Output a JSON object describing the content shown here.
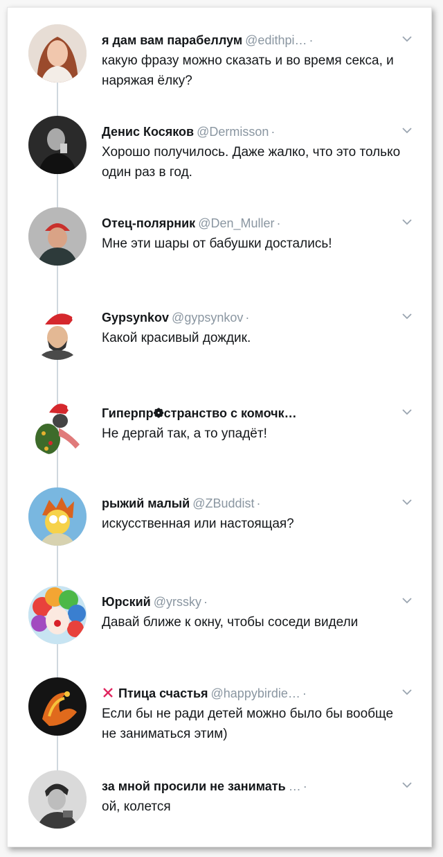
{
  "tweets": [
    {
      "name": "я дам вам парабеллум",
      "handle": "@edithpi…",
      "dot": "·",
      "text": "какую фразу можно сказать и во время секса, и наряжая ёлку?"
    },
    {
      "name": "Денис Косяков",
      "handle": "@Dermisson",
      "dot": "·",
      "text": "Хорошо получилось. Даже жалко, что это только один раз в год."
    },
    {
      "name": "Отец-полярник",
      "handle": "@Den_Muller",
      "dot": "·",
      "text": "Мне эти шары от бабушки достались!"
    },
    {
      "name": "Gypsynkov",
      "handle": "@gypsynkov",
      "dot": "·",
      "text": "Какой красивый дождик."
    },
    {
      "name": "Гиперпр❁странство с комочк…",
      "handle": "",
      "dot": "",
      "text": "Не дергай так, а то упадёт!"
    },
    {
      "name": "рыжий малый",
      "handle": "@ZBuddist",
      "dot": "·",
      "text": "искусственная или настоящая?"
    },
    {
      "name": "Юрский",
      "handle": "@yrssky",
      "dot": "·",
      "text": "Давай ближе к окну, чтобы соседи видели"
    },
    {
      "name": "Птица счастья",
      "handle": "@happybirdie…",
      "dot": "·",
      "text": "Если бы не ради детей можно было бы вообще не заниматься этим)"
    },
    {
      "name": "за мной просили не занимать",
      "handle": "…",
      "dot": "·",
      "text": "ой, колется"
    }
  ],
  "icons": {
    "more": "chevron-down-icon",
    "name_prefix": "red-x-icon"
  },
  "colors": {
    "name": "#14171a",
    "handle": "#8a96a1",
    "thread": "#cfd7de",
    "x_mark": "#e0245e"
  }
}
